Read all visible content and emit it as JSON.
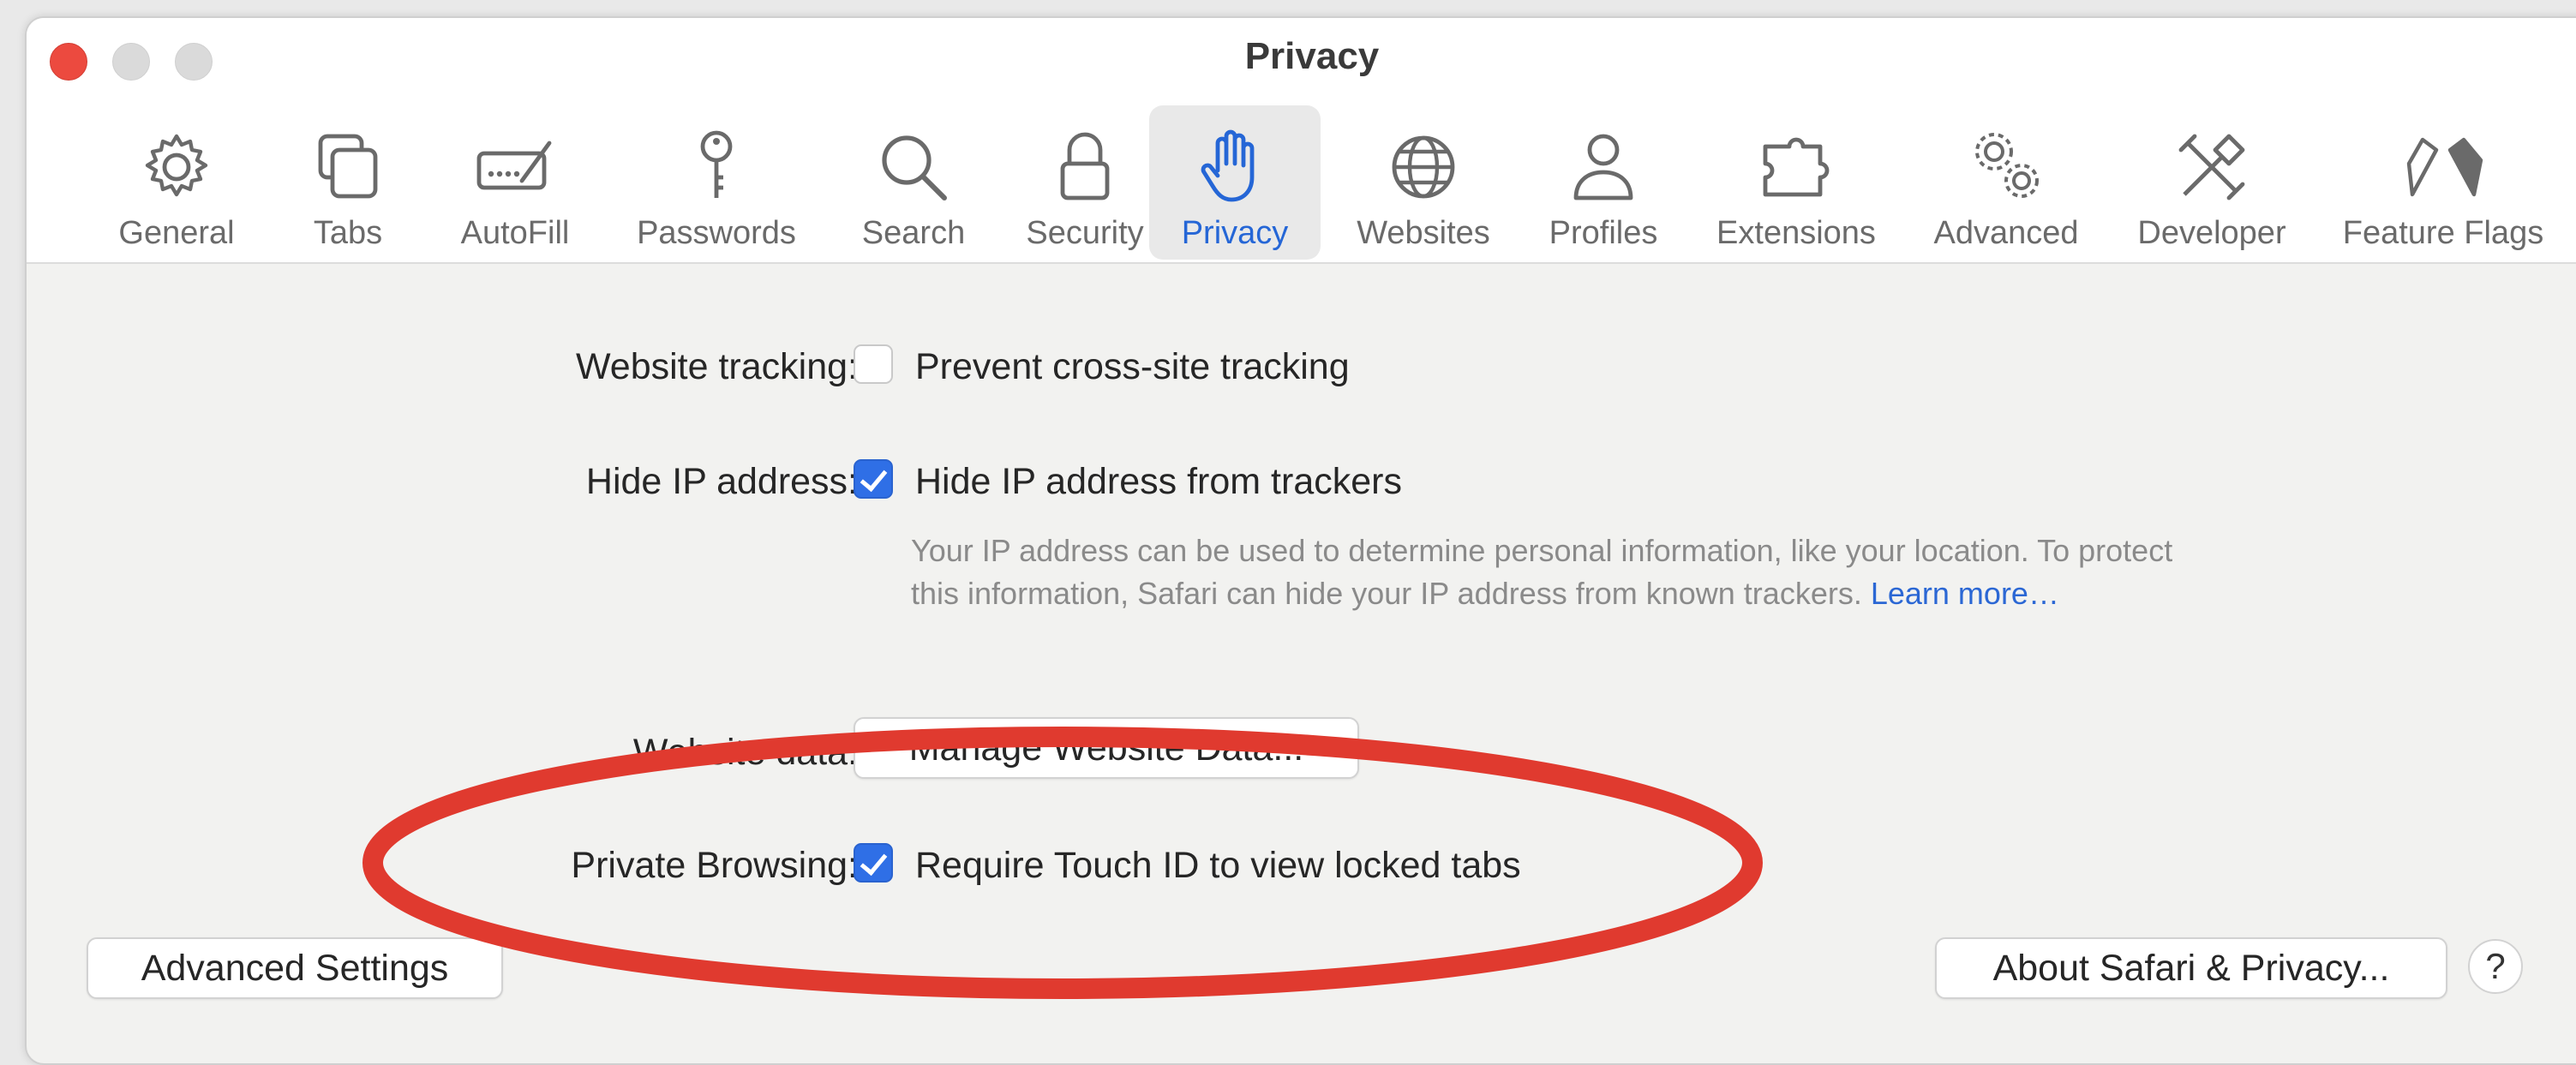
{
  "window": {
    "title": "Privacy"
  },
  "toolbar": {
    "items": [
      {
        "label": "General",
        "icon": "gear-icon"
      },
      {
        "label": "Tabs",
        "icon": "tabs-icon"
      },
      {
        "label": "AutoFill",
        "icon": "autofill-icon"
      },
      {
        "label": "Passwords",
        "icon": "key-icon"
      },
      {
        "label": "Search",
        "icon": "search-icon"
      },
      {
        "label": "Security",
        "icon": "lock-icon"
      },
      {
        "label": "Privacy",
        "icon": "hand-icon",
        "selected": true
      },
      {
        "label": "Websites",
        "icon": "globe-icon"
      },
      {
        "label": "Profiles",
        "icon": "person-icon"
      },
      {
        "label": "Extensions",
        "icon": "puzzle-icon"
      },
      {
        "label": "Advanced",
        "icon": "gears-icon"
      },
      {
        "label": "Developer",
        "icon": "tools-icon"
      },
      {
        "label": "Feature Flags",
        "icon": "flags-icon"
      }
    ]
  },
  "settings": {
    "website_tracking": {
      "label": "Website tracking:",
      "option": "Prevent cross-site tracking",
      "checked": false
    },
    "hide_ip": {
      "label": "Hide IP address:",
      "option": "Hide IP address from trackers",
      "checked": true,
      "description": "Your IP address can be used to determine personal information, like your location. To protect this information, Safari can hide your IP address from known trackers.",
      "learn_more": "Learn more…"
    },
    "website_data": {
      "label": "Website data:",
      "button": "Manage Website Data..."
    },
    "private_browsing": {
      "label": "Private Browsing:",
      "option": "Require Touch ID to view locked tabs",
      "checked": true
    }
  },
  "footer": {
    "advanced_settings": "Advanced Settings",
    "about": "About Safari & Privacy...",
    "help": "?"
  },
  "colors": {
    "accent": "#2f6fe6",
    "annotation": "#e03a2f",
    "close": "#ec4a3f"
  }
}
